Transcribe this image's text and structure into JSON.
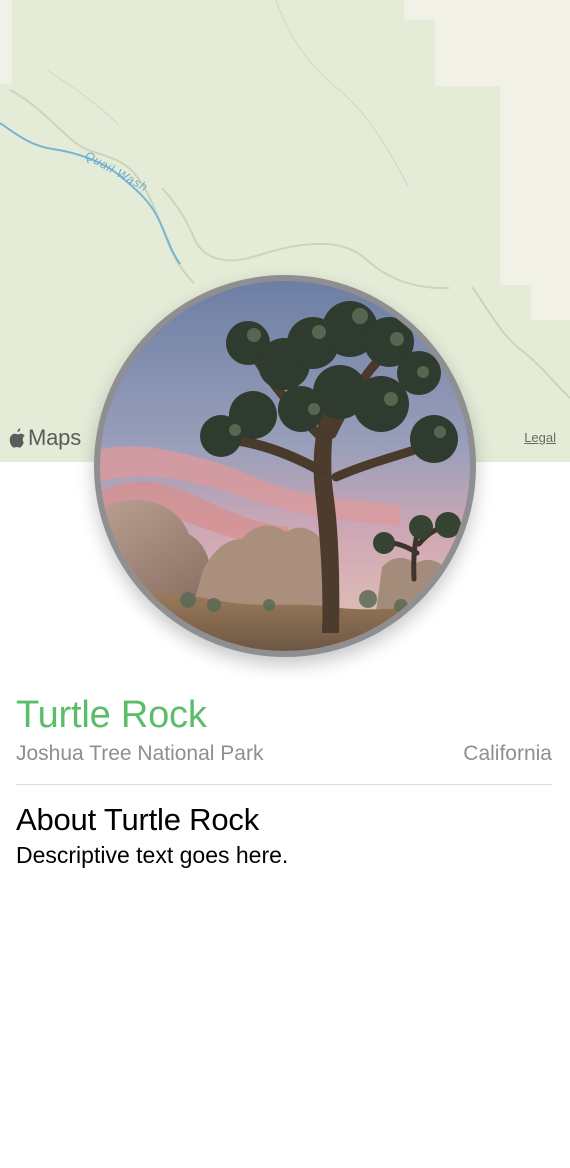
{
  "map": {
    "label": "Quail Wash",
    "brand": "Maps",
    "legal": "Legal",
    "colors": {
      "land": "#e4ecd8",
      "developed": "#f2f1e8",
      "water": "#76b5d6",
      "roads": "#c9d6bc"
    }
  },
  "park": {
    "name": "Turtle Rock",
    "park_name": "Joshua Tree National Park",
    "state": "California",
    "about_title": "About Turtle Rock",
    "description": "Descriptive text goes here.",
    "title_color": "#5cbd68",
    "secondary_text_color": "#8e8e93"
  },
  "icons": {
    "maps_logo": "apple-icon",
    "image": "joshua-tree-photo"
  }
}
